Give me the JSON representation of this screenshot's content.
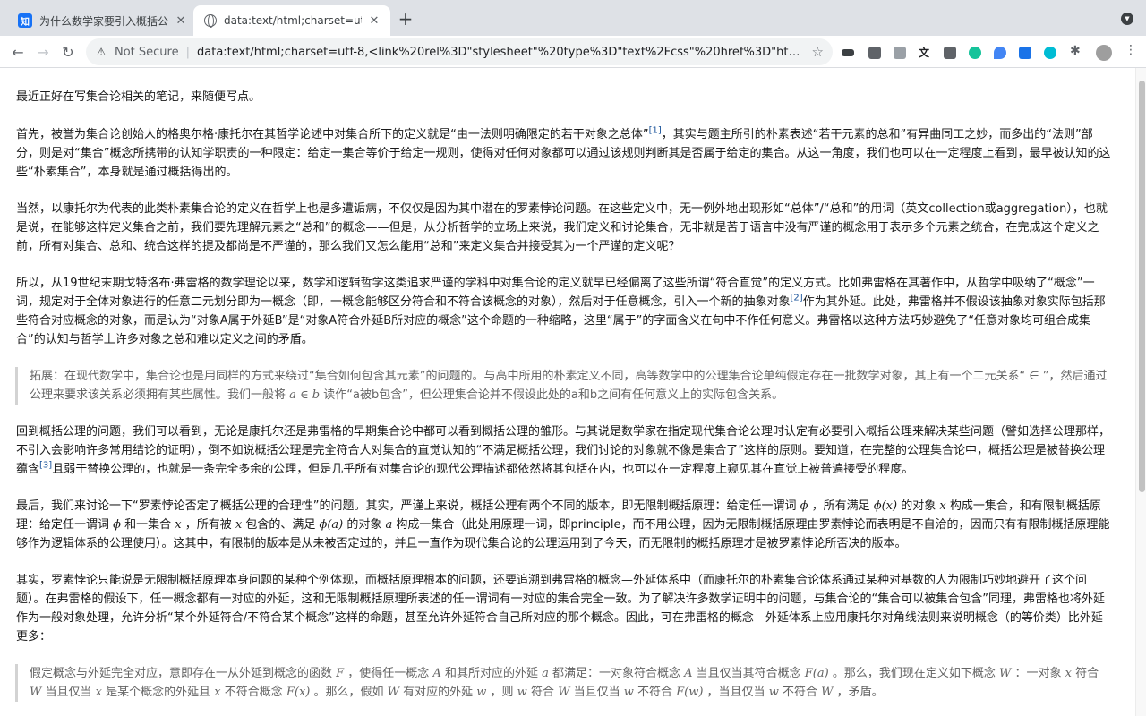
{
  "browser": {
    "tabs": [
      {
        "title": "为什么数学家要引入概括公理? - 知",
        "favicon": "zhihu-icon",
        "favicon_glyph": "知",
        "active": false
      },
      {
        "title": "data:text/html;charset=utf-8,<",
        "favicon": "globe-icon",
        "active": true
      }
    ],
    "new_tab_glyph": "+",
    "close_glyph": "✕",
    "address": {
      "security_label": "Not Secure",
      "separator": "|",
      "url": "data:text/html;charset=utf-8,<link%20rel%3D\"stylesheet\"%20type%3D\"text%2Fcss\"%20href%3D\"https%3A%2F..."
    }
  },
  "article": {
    "p1": "最近正好在写集合论相关的笔记，来随便写点。",
    "p2_a": "首先，被誉为集合论创始人的格奥尔格·康托尔在其哲学论述中对集合所下的定义就是“由一法则明确限定的若干对象之总体”",
    "p2_ref": "[1]",
    "p2_b": "，其实与题主所引的朴素表述“若干元素的总和”有异曲同工之妙，而多出的“法则”部分，则是对“集合”概念所携带的认知学职责的一种限定：给定一集合等价于给定一规则，使得对任何对象都可以通过该规则判断其是否属于给定的集合。从这一角度，我们也可以在一定程度上看到，最早被认知的这些“朴素集合”，本身就是通过概括得出的。",
    "p3": "当然，以康托尔为代表的此类朴素集合论的定义在哲学上也是多遭诟病，不仅仅是因为其中潜在的罗素悖论问题。在这些定义中，无一例外地出现形如“总体”/“总和”的用词（英文collection或aggregation），也就是说，在能够这样定义集合之前，我们要先理解元素之“总和”的概念——但是，从分析哲学的立场上来说，我们定义和讨论集合，无非就是苦于语言中没有严谨的概念用于表示多个元素之统合，在完成这个定义之前，所有对集合、总和、统合这样的提及都尚是不严谨的，那么我们又怎么能用“总和”来定义集合并接受其为一个严谨的定义呢？",
    "p4_a": "所以，从19世纪末期戈特洛布·弗雷格的数学理论以来，数学和逻辑哲学这类追求严谨的学科中对集合论的定义就早已经偏离了这些所谓“符合直觉”的定义方式。比如弗雷格在其著作中，从哲学中吸纳了“概念”一词，规定对于全体对象进行的任意二元划分即为一概念（即，一概念能够区分符合和不符合该概念的对象），然后对于任意概念，引入一个新的抽象对象",
    "p4_ref": "[2]",
    "p4_b": "作为其外延。此处，弗雷格并不假设该抽象对象实际包括那些符合对应概念的对象，而是认为“对象A属于外延B”是“对象A符合外延B所对应的概念”这个命题的一种缩略，这里“属于”的字面含义在句中不作任何意义。弗雷格以这种方法巧妙避免了“任意对象均可组合成集合”的认知与哲学上许多对象之总和难以定义之间的矛盾。",
    "q1_a": "拓展：在现代数学中，集合论也是用同样的方式来绕过“集合如何包含其元素”的问题的。与高中所用的朴素定义不同，高等数学中的公理集合论单纯假定存在一批数学对象，其上有一个二元关系“ ∈ ”，然后通过公理来要求该关系必须拥有某些属性。我们一般将 ",
    "q1_math": "a ∈ b",
    "q1_b": " 读作“a被b包含”，但公理集合论并不假设此处的a和b之间有任何意义上的实际包含关系。",
    "p5_a": "回到概括公理的问题，我们可以看到，无论是康托尔还是弗雷格的早期集合论中都可以看到概括公理的雏形。与其说是数学家在指定现代集合论公理时认定有必要引入概括公理来解决某些问题（譬如选择公理那样，不引入会影响许多常用结论的证明），倒不如说概括公理是完全符合人对集合的直觉认知的“不满足概括公理，我们讨论的对象就不像是集合了”这样的原则。要知道，在完整的公理集合论中，概括公理是被替换公理蕴含",
    "p5_ref": "[3]",
    "p5_b": "且弱于替换公理的，也就是一条完全多余的公理，但是几乎所有对集合论的现代公理描述都依然将其包括在内，也可以在一定程度上窥见其在直觉上被普遍接受的程度。",
    "p6_a": "最后，我们来讨论一下“罗素悖论否定了概括公理的合理性”的问题。其实，严谨上来说，概括公理有两个不同的版本，即无限制概括原理：给定任一谓词 ",
    "p6_m1": "ϕ",
    "p6_b": " ，所有满足 ",
    "p6_m2": "ϕ(x)",
    "p6_c": " 的对象 ",
    "p6_m3": "x",
    "p6_d": " 构成一集合，和有限制概括原理：给定任一谓词 ",
    "p6_m4": "ϕ",
    "p6_e": " 和一集合 ",
    "p6_m5": "x",
    "p6_f": " ，所有被 ",
    "p6_m6": "x",
    "p6_g": " 包含的、满足 ",
    "p6_m7": "ϕ(a)",
    "p6_h": " 的对象 ",
    "p6_m8": "a",
    "p6_i": " 构成一集合（此处用原理一词，即principle，而不用公理，因为无限制概括原理由罗素悖论而表明是不自洽的，因而只有有限制概括原理能够作为逻辑体系的公理使用）。这其中，有限制的版本是从未被否定过的，并且一直作为现代集合论的公理运用到了今天，而无限制的概括原理才是被罗素悖论所否决的版本。",
    "p7": "其实，罗素悖论只能说是无限制概括原理本身问题的某种个例体现，而概括原理根本的问题，还要追溯到弗雷格的概念—外延体系中（而康托尔的朴素集合论体系通过某种对基数的人为限制巧妙地避开了这个问题）。在弗雷格的假设下，任一概念都有一对应的外延，这和无限制概括原理所表述的任一谓词有一对应的集合完全一致。为了解决许多数学证明中的问题，与集合论的“集合可以被集合包含”同理，弗雷格也将外延作为一般对象处理，允许分析“某个外延符合/不符合某个概念”这样的命题，甚至允许外延符合自己所对应的那个概念。因此，可在弗雷格的概念—外延体系上应用康托尔对角线法则来说明概念（的等价类）比外延更多：",
    "q2_a": "假定概念与外延完全对应，意即存在一从外延到概念的函数 ",
    "q2_m1": "F",
    "q2_b": " ，使得任一概念 ",
    "q2_m2": "A",
    "q2_c": " 和其所对应的外延 ",
    "q2_m3": "a",
    "q2_d": " 都满足：一对象符合概念 ",
    "q2_m4": "A",
    "q2_e": " 当且仅当其符合概念 ",
    "q2_m5": "F(a)",
    "q2_f": " 。那么，我们现在定义如下概念 ",
    "q2_m6": "W",
    "q2_g": " ：一对象 ",
    "q2_m7": "x",
    "q2_h": " 符合 ",
    "q2_m8": "W",
    "q2_i": " 当且仅当 ",
    "q2_m9": "x",
    "q2_j": " 是某个概念的外延且 ",
    "q2_m10": "x",
    "q2_k": " 不符合概念 ",
    "q2_m11": "F(x)",
    "q2_l": " 。那么，假如 ",
    "q2_m12": "W",
    "q2_m": " 有对应的外延 ",
    "q2_m13": "w",
    "q2_n": " ，则 ",
    "q2_m14": "w",
    "q2_o": " 符合 ",
    "q2_m15": "W",
    "q2_p": " 当且仅当 ",
    "q2_m16": "w",
    "q2_q": " 不符合 ",
    "q2_m17": "F(w)",
    "q2_r": " ，当且仅当 ",
    "q2_m18": "w",
    "q2_s": " 不符合 ",
    "q2_m19": "W",
    "q2_t": " ，矛盾。"
  },
  "colors": {
    "tabstrip": "#dee1e6",
    "link": "#175199",
    "quote_text": "#646464"
  }
}
